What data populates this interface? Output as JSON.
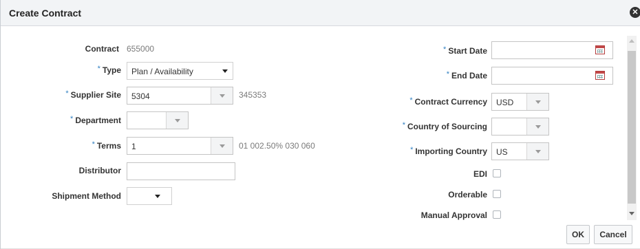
{
  "dialog": {
    "title": "Create Contract",
    "close_icon": "close-icon"
  },
  "left": {
    "contract_label": "Contract",
    "contract_value": "655000",
    "type_label": "Type",
    "type_value": "Plan / Availability",
    "supplier_site_label": "Supplier Site",
    "supplier_site_value": "5304",
    "supplier_site_desc": "345353",
    "department_label": "Department",
    "department_value": "",
    "terms_label": "Terms",
    "terms_value": "1",
    "terms_desc": "01 002.50% 030 060",
    "distributor_label": "Distributor",
    "distributor_value": "",
    "shipment_method_label": "Shipment Method",
    "shipment_method_value": ""
  },
  "right": {
    "start_date_label": "Start Date",
    "start_date_value": "",
    "end_date_label": "End Date",
    "end_date_value": "",
    "contract_currency_label": "Contract Currency",
    "contract_currency_value": "USD",
    "country_of_sourcing_label": "Country of Sourcing",
    "country_of_sourcing_value": "",
    "importing_country_label": "Importing Country",
    "importing_country_value": "US",
    "edi_label": "EDI",
    "edi_checked": false,
    "orderable_label": "Orderable",
    "orderable_checked": false,
    "manual_approval_label": "Manual Approval",
    "manual_approval_checked": false
  },
  "required_marker": "*",
  "buttons": {
    "ok": "OK",
    "cancel": "Cancel"
  },
  "colors": {
    "required": "#2f7fc1",
    "header_bg": "#f2f4f6",
    "calendar_icon": "#c24848"
  }
}
